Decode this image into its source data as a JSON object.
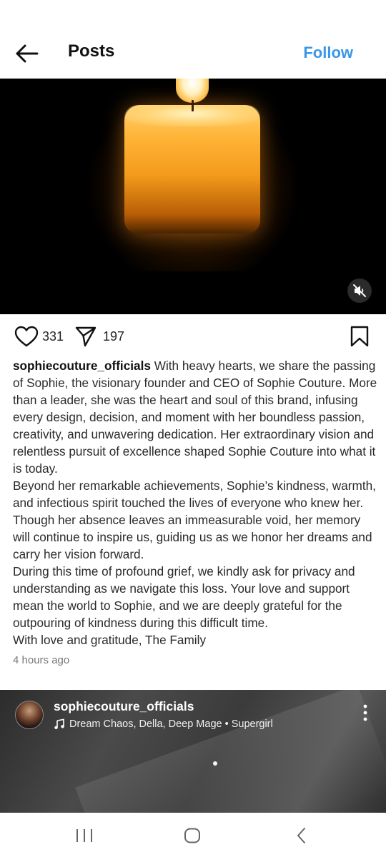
{
  "header": {
    "title": "Posts",
    "follow_label": "Follow",
    "back_icon": "arrow-left-icon"
  },
  "media": {
    "type": "video",
    "subject": "lit candle on black background",
    "mute_icon": "muted-speaker-icon"
  },
  "actions": {
    "like_count": "331",
    "share_count": "197",
    "like_icon": "heart-outline-icon",
    "share_icon": "send-icon",
    "save_icon": "bookmark-icon"
  },
  "caption": {
    "username": "sophiecouture_officials",
    "paragraphs": [
      "With heavy hearts, we share the passing of Sophie, the visionary founder and CEO of Sophie Couture. More than a leader, she was the heart and soul of this brand, infusing every design, decision, and moment with her boundless passion, creativity, and unwavering dedication. Her extraordinary vision and relentless pursuit of excellence shaped Sophie Couture into what it is today.",
      "Beyond her remarkable achievements, Sophie’s kindness, warmth, and infectious spirit touched the lives of everyone who knew her. Though her absence leaves an immeasurable void, her memory will continue to inspire us, guiding us as we honor her dreams and carry her vision forward.",
      "During this time of profound grief, we kindly ask for privacy and understanding as we navigate this loss. Your love and support mean the world to Sophie, and we are deeply grateful for the outpouring of kindness during this difficult time.",
      "With love and gratitude, The Family"
    ]
  },
  "timestamp": "4 hours ago",
  "next_post": {
    "username": "sophiecouture_officials",
    "music": "Dream Chaos, Della, Deep Mage • Supergirl",
    "music_icon": "music-note-icon",
    "more_icon": "vertical-dots-icon"
  },
  "system_nav": {
    "recents_icon": "recent-apps-icon",
    "home_icon": "home-icon",
    "back_icon": "chevron-left-icon"
  },
  "colors": {
    "accent": "#3a97e8",
    "text": "#262626",
    "muted": "#777777"
  }
}
